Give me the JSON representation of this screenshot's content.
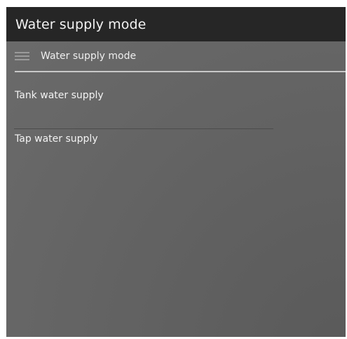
{
  "app": {
    "title": "Water supply mode"
  },
  "subheader": {
    "menu_icon": "hamburger-menu-icon",
    "label": "Water supply mode"
  },
  "options": [
    {
      "label": "Tank water supply"
    },
    {
      "label": "Tap water supply"
    }
  ],
  "colors": {
    "title_bar": "#262626",
    "background": "#636363",
    "text": "#f2f2f2",
    "divider": "#c8c8c8"
  }
}
